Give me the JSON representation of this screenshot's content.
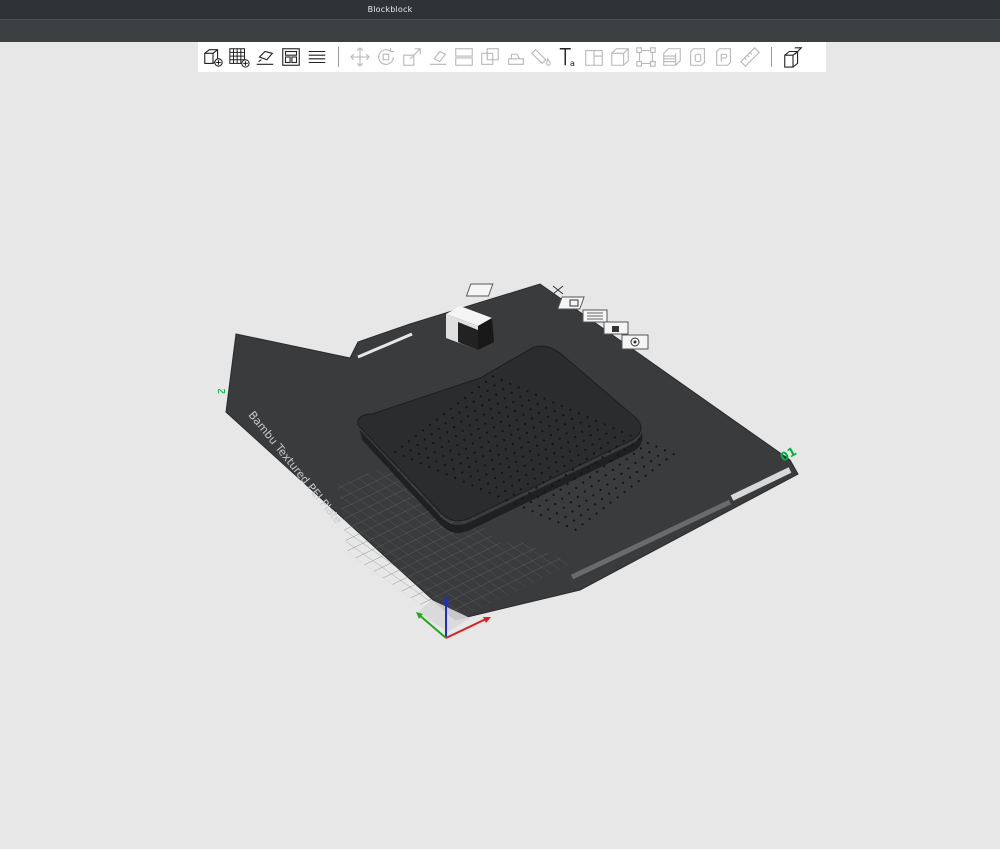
{
  "window": {
    "title": "Blockblock"
  },
  "toolbar": {
    "left_tools": [
      {
        "name": "add-object-icon"
      },
      {
        "name": "add-plate-icon"
      },
      {
        "name": "auto-orient-icon"
      },
      {
        "name": "arrange-icon"
      },
      {
        "name": "layers-icon"
      }
    ],
    "center_tools": [
      {
        "name": "move-icon"
      },
      {
        "name": "rotate-icon"
      },
      {
        "name": "scale-icon"
      },
      {
        "name": "lay-on-face-icon"
      },
      {
        "name": "split-icon"
      },
      {
        "name": "boolean-icon"
      },
      {
        "name": "support-painting-icon"
      },
      {
        "name": "color-painting-icon"
      },
      {
        "name": "text-icon"
      },
      {
        "name": "cut-icon"
      },
      {
        "name": "measure-icon"
      },
      {
        "name": "assembly-icon"
      },
      {
        "name": "variable-layer-icon"
      },
      {
        "name": "seam-painting-icon"
      },
      {
        "name": "fuzzy-skin-icon"
      },
      {
        "name": "ruler-icon"
      }
    ],
    "right_tools": [
      {
        "name": "edit-export-icon"
      }
    ]
  },
  "plate": {
    "name_label": "Bambu Textured PEI Plate",
    "number_label": "01",
    "side_marker": "∿"
  },
  "colors": {
    "titlebar": "#2f3336",
    "menubar": "#3b4043",
    "plate": "#3a3b3c",
    "model": "#2b2c2d",
    "axis_x": "#d62222",
    "axis_y": "#1fa81f",
    "axis_z": "#1d2ecc",
    "accent": "#00ae42"
  }
}
